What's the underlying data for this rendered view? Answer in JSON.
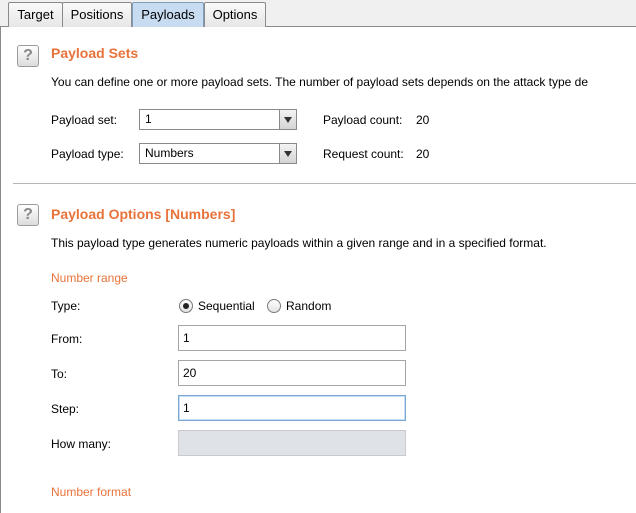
{
  "tabs": [
    {
      "label": "Target"
    },
    {
      "label": "Positions"
    },
    {
      "label": "Payloads",
      "active": true
    },
    {
      "label": "Options"
    }
  ],
  "payload_sets": {
    "help_glyph": "?",
    "title": "Payload Sets",
    "description": "You can define one or more payload sets. The number of payload sets depends on the attack type de",
    "payload_set_label": "Payload set:",
    "payload_set_value": "1",
    "payload_type_label": "Payload type:",
    "payload_type_value": "Numbers",
    "payload_count_label": "Payload count:",
    "payload_count_value": "20",
    "request_count_label": "Request count:",
    "request_count_value": "20"
  },
  "payload_options": {
    "help_glyph": "?",
    "title": "Payload Options [Numbers]",
    "description": "This payload type generates numeric payloads within a given range and in a specified format.",
    "number_range_heading": "Number range",
    "type_label": "Type:",
    "type_options": [
      {
        "label": "Sequential",
        "selected": true
      },
      {
        "label": "Random",
        "selected": false
      }
    ],
    "from_label": "From:",
    "from_value": "1",
    "to_label": "To:",
    "to_value": "20",
    "step_label": "Step:",
    "step_value": "1",
    "how_many_label": "How many:",
    "how_many_value": "",
    "number_format_heading": "Number format"
  },
  "colors": {
    "accent": "#e8733a",
    "active_tab": "#c7dbf1",
    "disabled_field": "#dfe2e6"
  },
  "icons": {
    "help": "help-icon",
    "dropdown": "chevron-down-icon"
  }
}
